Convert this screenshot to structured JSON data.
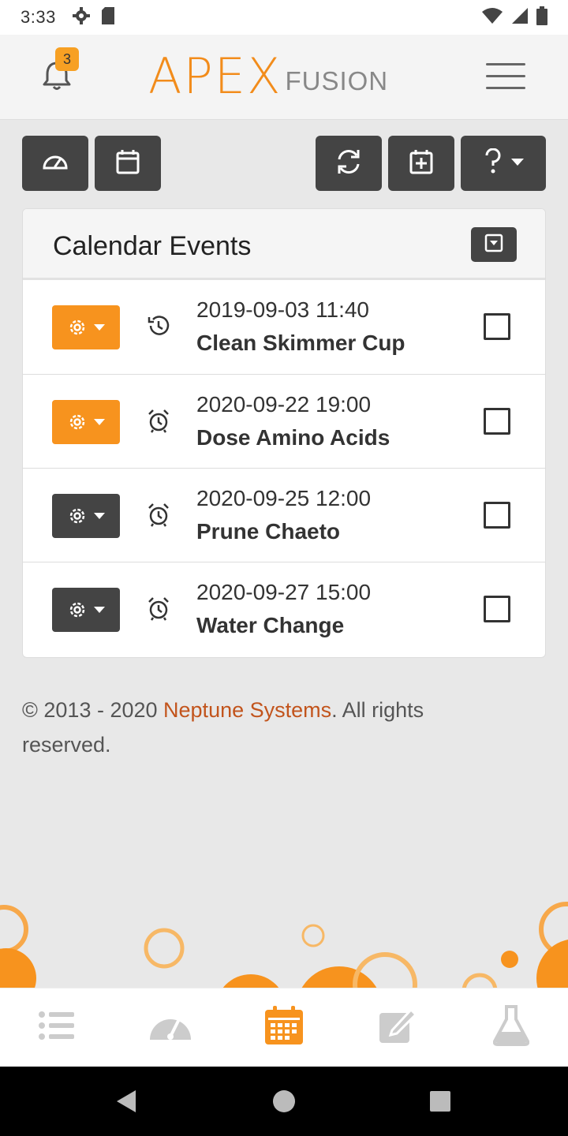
{
  "status_bar": {
    "time": "3:33",
    "left_icons": [
      "settings-icon",
      "sd-card-icon"
    ],
    "right_icons": [
      "wifi-icon",
      "signal-icon",
      "battery-icon"
    ]
  },
  "header": {
    "notification_count": "3",
    "logo_primary": "APEX",
    "logo_secondary": "FUSION",
    "menu_icon": "hamburger-menu-icon"
  },
  "toolbar": {
    "left_buttons": [
      "dashboard-icon",
      "calendar-icon"
    ],
    "right_buttons": [
      "refresh-icon",
      "add-event-icon",
      "help-dropdown-icon"
    ]
  },
  "calendar": {
    "title": "Calendar Events",
    "events": [
      {
        "datetime": "2019-09-03 11:40",
        "name": "Clean Skimmer Cup",
        "status_icon": "history-icon",
        "button_color": "#f7931e"
      },
      {
        "datetime": "2020-09-22 19:00",
        "name": "Dose Amino Acids",
        "status_icon": "alarm-clock-icon",
        "button_color": "#f7931e"
      },
      {
        "datetime": "2020-09-25 12:00",
        "name": "Prune Chaeto",
        "status_icon": "alarm-clock-icon",
        "button_color": "#444444"
      },
      {
        "datetime": "2020-09-27 15:00",
        "name": "Water Change",
        "status_icon": "alarm-clock-icon",
        "button_color": "#444444"
      }
    ]
  },
  "footer": {
    "prefix": "© 2013 - 2020 ",
    "link": "Neptune Systems",
    "suffix": ". All rights reserved."
  },
  "bottom_nav": {
    "items": [
      "list-icon",
      "gauge-icon",
      "calendar-grid-icon",
      "edit-icon",
      "flask-icon"
    ],
    "active_index": 2
  },
  "colors": {
    "accent": "#f7931e",
    "dark_button": "#444444",
    "link": "#c2541c",
    "inactive_nav": "#cccccc"
  }
}
